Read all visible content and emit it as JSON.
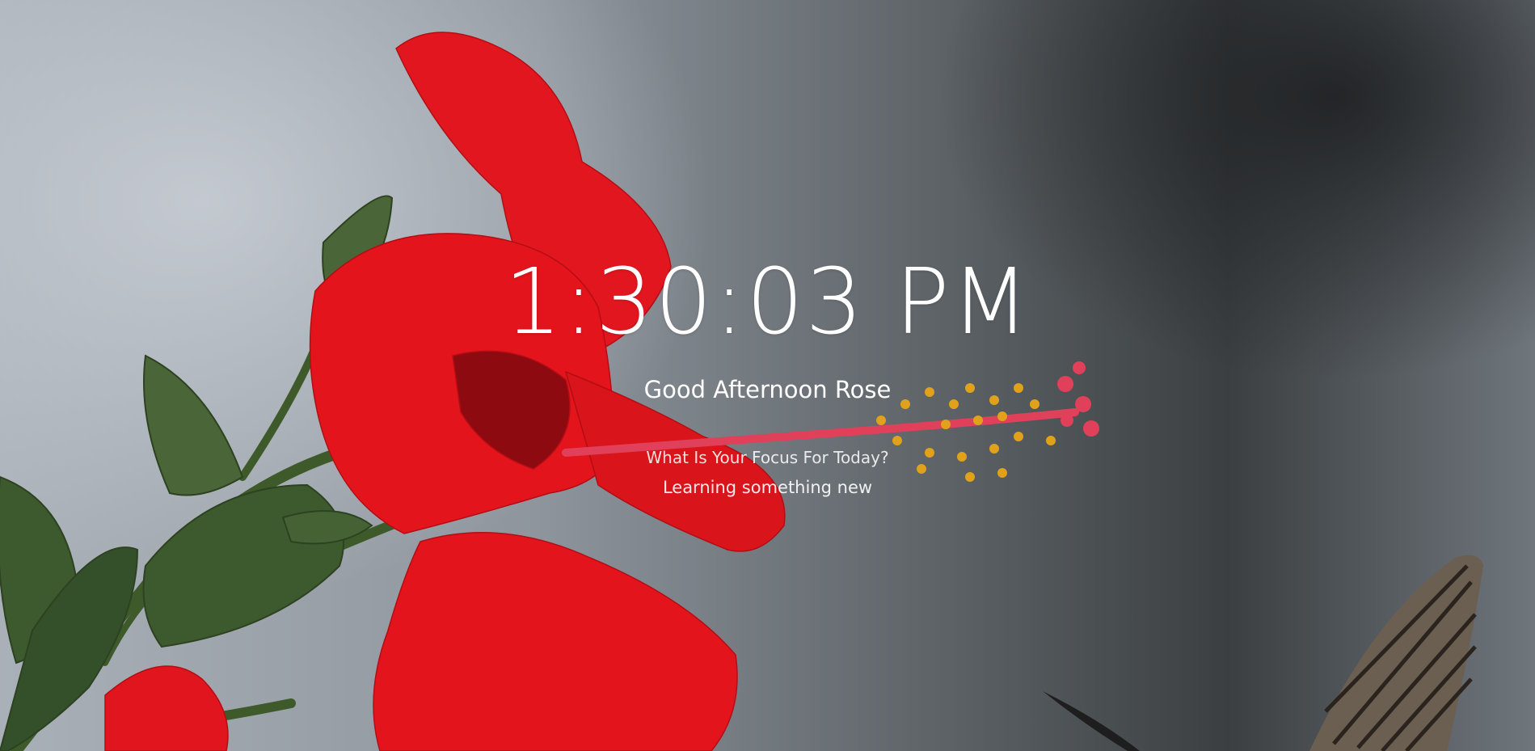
{
  "clock": {
    "time": "1:30:03 PM"
  },
  "greeting": {
    "text": "Good Afternoon Rose"
  },
  "focus": {
    "question": "What Is Your Focus For Today?",
    "answer": "Learning something new"
  },
  "background": {
    "description_icon": "hibiscus-photo",
    "colors": {
      "petal": "#e3141c",
      "leaf": "#3d5a2e",
      "stamen": "#e0a21a"
    }
  }
}
